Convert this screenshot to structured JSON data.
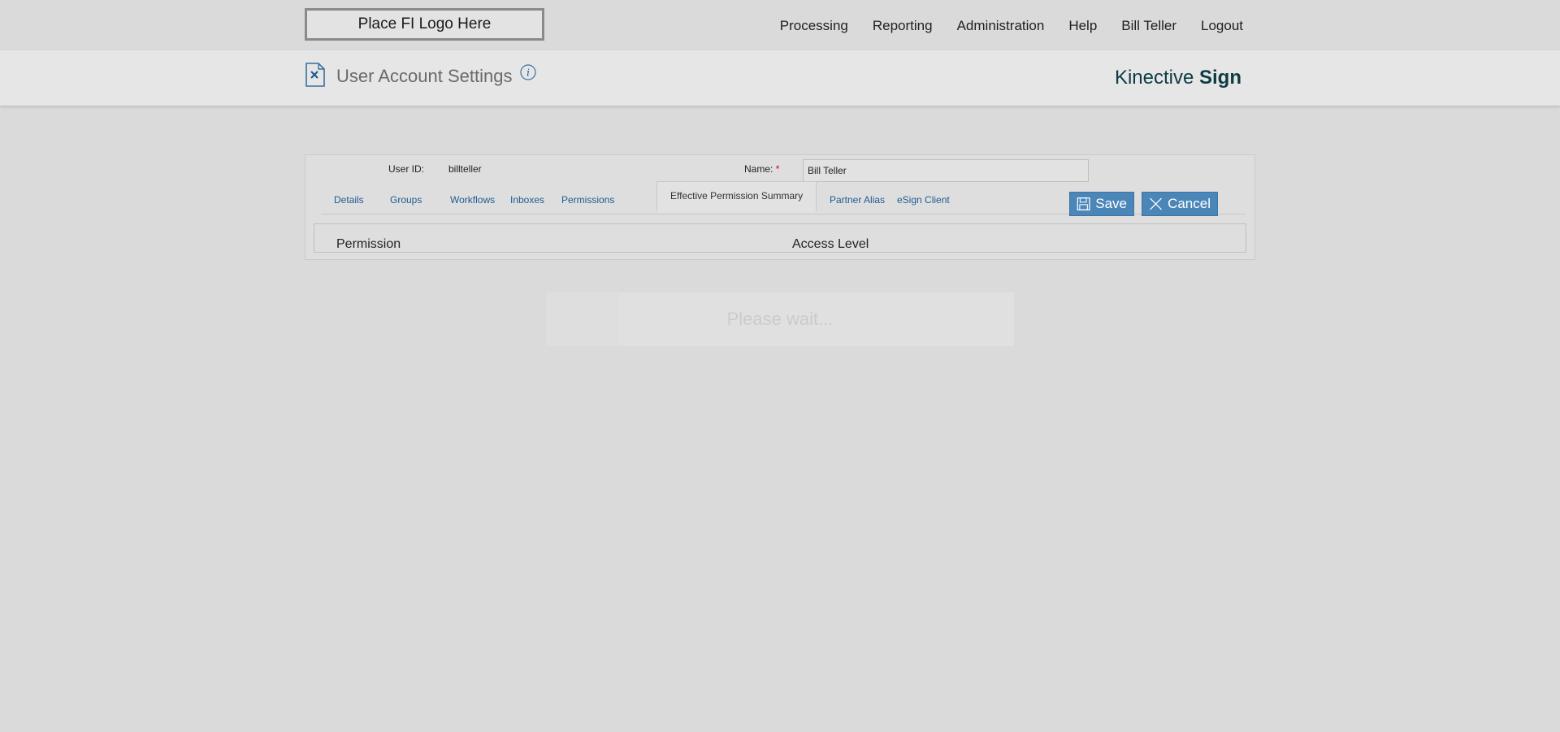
{
  "header": {
    "logo_text": "Place FI Logo Here",
    "nav": [
      "Processing",
      "Reporting",
      "Administration",
      "Help",
      "Bill Teller",
      "Logout"
    ]
  },
  "titlebar": {
    "title": "User Account Settings",
    "brand_light": "Kinective ",
    "brand_bold": "Sign"
  },
  "form": {
    "user_id_label": "User ID:",
    "user_id_value": "billteller",
    "name_label": "Name:",
    "name_required": "*",
    "name_value": "Bill Teller"
  },
  "tabs": [
    "Details",
    "Groups",
    "Workflows",
    "Inboxes",
    "Permissions",
    "Effective Permission Summary",
    "Partner Alias",
    "eSign Client"
  ],
  "active_tab": "Effective Permission Summary",
  "buttons": {
    "save_label": "Save",
    "cancel_label": "Cancel"
  },
  "grid": {
    "columns": [
      "Permission",
      "Access Level"
    ]
  },
  "loading": {
    "text": "Please wait..."
  },
  "colors": {
    "accent": "#4b86b9",
    "link": "#1f5b95",
    "brand": "#0e3b44",
    "required": "#d0021b"
  }
}
